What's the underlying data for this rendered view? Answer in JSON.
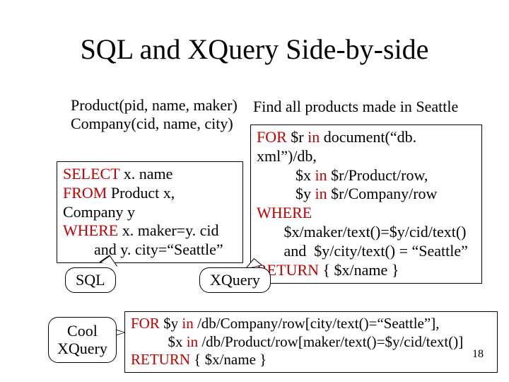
{
  "title": "SQL and XQuery Side-by-side",
  "schema": {
    "line1": "Product(pid, name, maker)",
    "line2": "Company(cid, name, city)"
  },
  "task": "Find all products made in Seattle",
  "sql": {
    "l1a": "SELECT",
    "l1b": " x. name",
    "l2a": "FROM",
    "l2b": " Product x, Company y",
    "l3a": "WHERE",
    "l3b": " x. maker=y. cid",
    "l4": "        and y. city=“Seattle”"
  },
  "xquery": {
    "l1a": "FOR",
    "l1b": " $r ",
    "l1c": "in",
    "l1d": " document(“db. xml”)/db,",
    "l2": "          $x ",
    "l2c": "in",
    "l2d": " $r/Product/row,",
    "l3": "          $y ",
    "l3c": "in",
    "l3d": " $r/Company/row",
    "l4": "WHERE",
    "l5": "       $x/maker/text()=$y/cid/text()",
    "l6": "       and  $y/city/text() = “Seattle”",
    "l7a": "RETURN",
    "l7b": " { $x/name }"
  },
  "cool": {
    "l1a": "FOR",
    "l1b": " $y ",
    "l1c": "in",
    "l1d": " /db/Company/row[city/text()=“Seattle”],",
    "l2": "          $x ",
    "l2c": "in",
    "l2d": " /db/Product/row[maker/text()=$y/cid/text()]",
    "l3a": "RETURN",
    "l3b": " { $x/name }"
  },
  "labels": {
    "sql": "SQL",
    "xquery": "XQuery",
    "cool_l1": "Cool",
    "cool_l2": "XQuery"
  },
  "page": "18"
}
